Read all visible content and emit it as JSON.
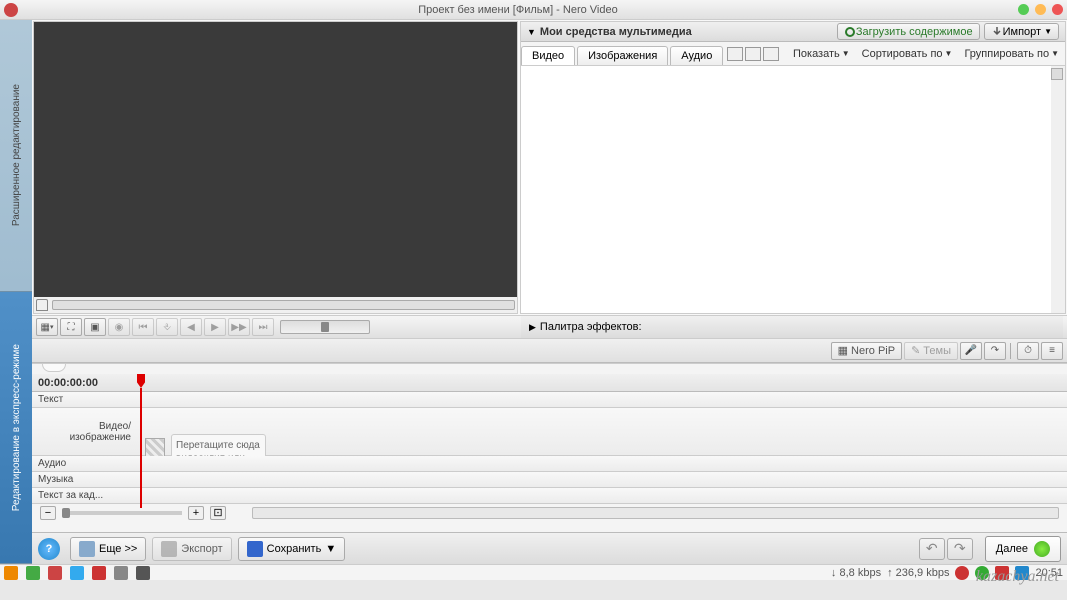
{
  "titlebar": {
    "title": "Проект без имени [Фильм] - Nero Video"
  },
  "rail": {
    "top": "Расширенное редактирование",
    "bottom": "Редактирование в экспресс-режиме"
  },
  "media": {
    "header": "Мои средства мультимедиа",
    "load_btn": "Загрузить содержимое",
    "import_btn": "Импорт",
    "tabs": {
      "video": "Видео",
      "images": "Изображения",
      "audio": "Аудио"
    },
    "show": "Показать",
    "sort": "Сортировать по",
    "group": "Группировать по"
  },
  "effects": {
    "label": "Палитра эффектов:"
  },
  "tools": {
    "nero_pip": "Nero PiP",
    "themes": "Темы"
  },
  "timeline": {
    "time": "00:00:00:00",
    "tracks": {
      "text": "Текст",
      "video": "Видео/\nизображение",
      "audio": "Аудио",
      "music": "Музыка",
      "text_over": "Текст за кад..."
    },
    "drop_hint": "Перетащите сюда видеоклип или изображение"
  },
  "bottom": {
    "more": "Еще >>",
    "export": "Экспорт",
    "save": "Сохранить",
    "next": "Далее"
  },
  "status": {
    "down": "8,8 kbps",
    "up": "236,9 kbps",
    "time": "20:51"
  },
  "watermark": "kazachya.net"
}
